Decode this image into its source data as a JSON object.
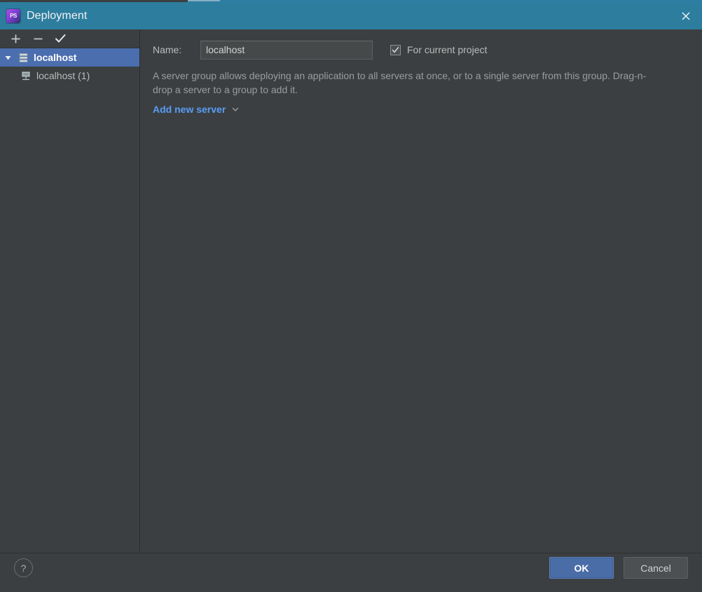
{
  "window": {
    "title": "Deployment",
    "app_icon": "phpstorm-icon",
    "close_icon": "close-icon",
    "titlebar_color": "#2d7d9e",
    "background_color": "#3c3f41"
  },
  "tree_toolbar": {
    "buttons": [
      {
        "name": "add-button",
        "icon": "plus-icon",
        "tooltip": "Add"
      },
      {
        "name": "remove-button",
        "icon": "minus-icon",
        "tooltip": "Remove"
      },
      {
        "name": "apply-button",
        "icon": "check-icon",
        "tooltip": "Use as default"
      }
    ]
  },
  "tree": {
    "items": [
      {
        "label": "localhost",
        "icon": "server-group-icon",
        "selected": true,
        "expanded": true,
        "arrow": "chevron-down-icon",
        "level": 0
      },
      {
        "label": "localhost (1)",
        "icon": "remote-server-icon",
        "selected": false,
        "level": 1
      }
    ],
    "selection_color": "#4b6eaf"
  },
  "detail": {
    "name_label": "Name:",
    "name_value": "localhost",
    "name_placeholder": "",
    "checkbox_label": "For current project",
    "checkbox_checked": true,
    "description": "A server group allows deploying an application to all servers at once, or to a single server from this group. Drag-n-drop a server to a group to add it.",
    "link_label": "Add new server",
    "link_icon": "chevron-down-icon",
    "link_color": "#589df6"
  },
  "bottom": {
    "help_label": "?",
    "ok_label": "OK",
    "cancel_label": "Cancel",
    "ok_color": "#4a6da7"
  }
}
